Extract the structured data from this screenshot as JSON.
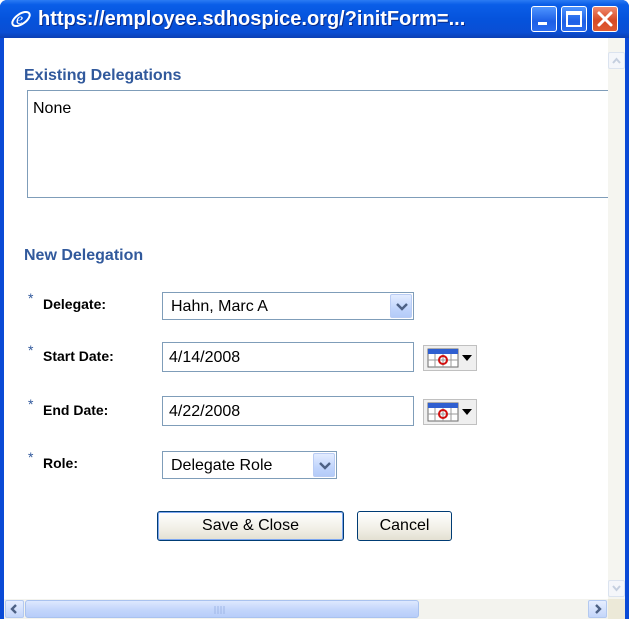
{
  "window": {
    "title": "https://employee.sdhospice.org/?initForm=...",
    "icon": "ie-icon"
  },
  "existing": {
    "heading": "Existing Delegations",
    "content": "None"
  },
  "new_delegation": {
    "heading": "New Delegation",
    "required_marker": "*",
    "delegate": {
      "label": "Delegate:",
      "value": "Hahn, Marc A"
    },
    "start_date": {
      "label": "Start Date:",
      "value": "4/14/2008"
    },
    "end_date": {
      "label": "End Date:",
      "value": "4/22/2008"
    },
    "role": {
      "label": "Role:",
      "value": "Delegate Role"
    }
  },
  "buttons": {
    "save": "Save & Close",
    "cancel": "Cancel"
  },
  "colors": {
    "title_bar": "#0553dc",
    "heading": "#31599c",
    "close_button": "#d74a25"
  }
}
